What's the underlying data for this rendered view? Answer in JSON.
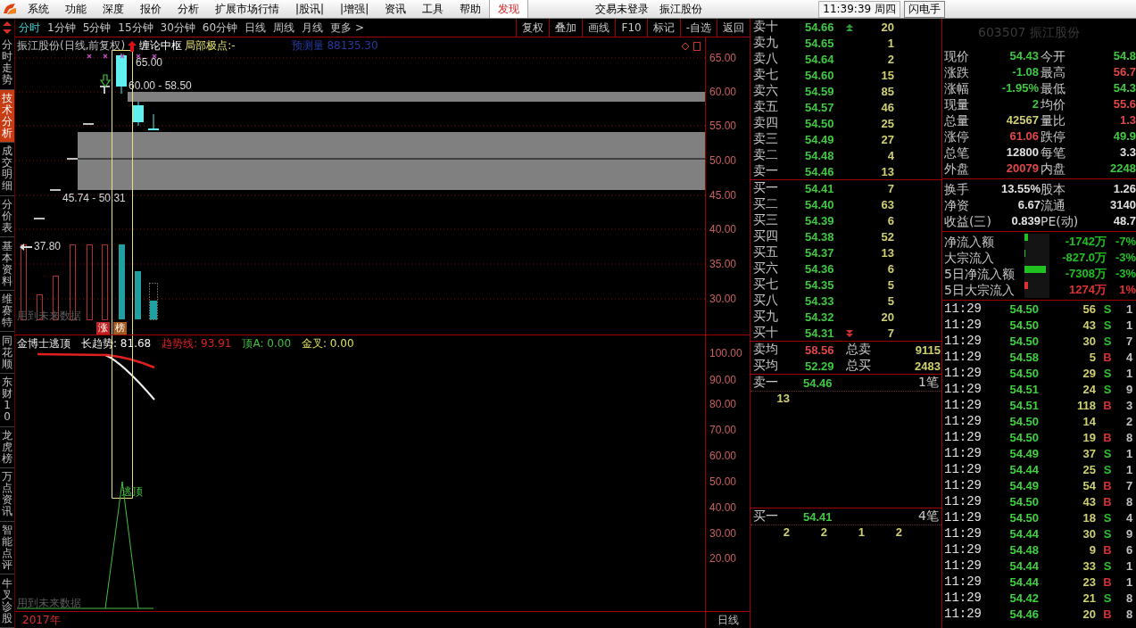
{
  "menu_bar": {
    "items": [
      {
        "label": "系统",
        "highlighted": false
      },
      {
        "label": "功能",
        "highlighted": false
      },
      {
        "label": "深度",
        "highlighted": false
      },
      {
        "label": "报价",
        "highlighted": false
      },
      {
        "label": "分析",
        "highlighted": false
      },
      {
        "label": "扩展市场行情",
        "highlighted": false
      },
      {
        "label": "|股讯|",
        "highlighted": false
      },
      {
        "label": "|增强|",
        "highlighted": false
      },
      {
        "label": "资讯",
        "highlighted": false
      },
      {
        "label": "工具",
        "highlighted": false
      },
      {
        "label": "帮助",
        "highlighted": false
      },
      {
        "label": "发现",
        "highlighted": true
      }
    ],
    "login_status": "交易未登录",
    "stock_name": "振江股份",
    "clock": "11:39:39 周四",
    "button": "闪电手"
  },
  "side_tabs": [
    {
      "label": "分时走势",
      "selected": false
    },
    {
      "label": "技术分析",
      "selected": true
    },
    {
      "label": "成交明细",
      "selected": false
    },
    {
      "label": "分价表",
      "selected": false
    },
    {
      "label": "基本资料",
      "selected": false
    },
    {
      "label": "维赛特",
      "selected": false
    },
    {
      "label": "同花顺",
      "selected": false
    },
    {
      "label": "东财10",
      "selected": false
    },
    {
      "label": "龙虎榜",
      "selected": false
    },
    {
      "label": "万点资讯",
      "selected": false
    },
    {
      "label": "智能点评",
      "selected": false
    },
    {
      "label": "牛叉诊股",
      "selected": false
    }
  ],
  "period_tabs": [
    {
      "label": "分时",
      "selected": true
    },
    {
      "label": "1分钟",
      "selected": false
    },
    {
      "label": "5分钟",
      "selected": false
    },
    {
      "label": "15分钟",
      "selected": false
    },
    {
      "label": "30分钟",
      "selected": false
    },
    {
      "label": "60分钟",
      "selected": false
    },
    {
      "label": "日线",
      "selected": false
    },
    {
      "label": "周线",
      "selected": false
    },
    {
      "label": "月线",
      "selected": false
    },
    {
      "label": "更多 >",
      "selected": false
    }
  ],
  "toolbar_buttons": [
    "复权",
    "叠加",
    "画线",
    "F10",
    "标记",
    "-自选",
    "返回"
  ],
  "main_chart": {
    "title": "振江股份(日线,前复权)",
    "overlay": "缠论中枢",
    "extreme_label": "局部极点:-",
    "forecast": "预测量 88135.30",
    "price_labels": [
      "65.00",
      "60.00 - 58.50",
      "45.74 - 50.31",
      "37.80"
    ],
    "note": "用到未来数据",
    "tags": [
      {
        "label": "涨",
        "color": "#c02020"
      },
      {
        "label": "榜",
        "color": "#a05a20"
      }
    ],
    "y_labels": [
      "65.00",
      "60.00",
      "55.00",
      "50.00",
      "45.00",
      "40.00",
      "35.00",
      "30.00"
    ]
  },
  "indicator_chart": {
    "name": "金博士逃顶",
    "lines": [
      {
        "label": "长趋势: 81.68",
        "color": "#f0f0f0"
      },
      {
        "label": "趋势线: 93.91",
        "color": "#e02020"
      },
      {
        "label": "顶A: 0.00",
        "color": "#40c040"
      },
      {
        "label": "金叉: 0.00",
        "color": "#e0e060"
      }
    ],
    "signal": "逃顶",
    "note": "用到未来数据",
    "y_labels": [
      "100.00",
      "90.00",
      "80.00",
      "70.00",
      "60.00",
      "50.00",
      "40.00",
      "30.00",
      "20.00"
    ]
  },
  "footer": {
    "year": "2017年",
    "period": "日线"
  },
  "order_book": {
    "asks": [
      {
        "label": "卖十",
        "price": "54.66",
        "volume": "20"
      },
      {
        "label": "卖九",
        "price": "54.65",
        "volume": "1"
      },
      {
        "label": "卖八",
        "price": "54.64",
        "volume": "2"
      },
      {
        "label": "卖七",
        "price": "54.60",
        "volume": "15"
      },
      {
        "label": "卖六",
        "price": "54.59",
        "volume": "85"
      },
      {
        "label": "卖五",
        "price": "54.57",
        "volume": "46"
      },
      {
        "label": "卖四",
        "price": "54.50",
        "volume": "25"
      },
      {
        "label": "卖三",
        "price": "54.49",
        "volume": "27"
      },
      {
        "label": "卖二",
        "price": "54.48",
        "volume": "4"
      },
      {
        "label": "卖一",
        "price": "54.46",
        "volume": "13"
      }
    ],
    "bids": [
      {
        "label": "买一",
        "price": "54.41",
        "volume": "7"
      },
      {
        "label": "买二",
        "price": "54.40",
        "volume": "63"
      },
      {
        "label": "买三",
        "price": "54.39",
        "volume": "6"
      },
      {
        "label": "买四",
        "price": "54.38",
        "volume": "52"
      },
      {
        "label": "买五",
        "price": "54.37",
        "volume": "13"
      },
      {
        "label": "买六",
        "price": "54.36",
        "volume": "6"
      },
      {
        "label": "买七",
        "price": "54.35",
        "volume": "5"
      },
      {
        "label": "买八",
        "price": "54.33",
        "volume": "5"
      },
      {
        "label": "买九",
        "price": "54.32",
        "volume": "20"
      },
      {
        "label": "买十",
        "price": "54.31",
        "volume": "7"
      }
    ],
    "averages": [
      {
        "label": "卖均",
        "price": "58.56",
        "color": "#e04848",
        "total_label": "总卖",
        "total": "9115"
      },
      {
        "label": "买均",
        "price": "52.29",
        "color": "#40c840",
        "total_label": "总买",
        "total": "2483"
      }
    ],
    "queues": [
      {
        "label": "卖一",
        "price": "54.46",
        "count": "1笔",
        "orders": [
          "13"
        ]
      },
      {
        "label": "买一",
        "price": "54.41",
        "count": "4笔",
        "orders": [
          "2",
          "2",
          "1",
          "2"
        ]
      }
    ]
  },
  "quote": {
    "title": "603507 振江股份",
    "fields": [
      {
        "label": "现价",
        "value": "54.43",
        "color": "#40c840"
      },
      {
        "label": "今开",
        "value": "54.8",
        "color": "#40c840"
      },
      {
        "label": "涨跌",
        "value": "-1.08",
        "color": "#40c840"
      },
      {
        "label": "最高",
        "value": "56.7",
        "color": "#e04848"
      },
      {
        "label": "涨幅",
        "value": "-1.95%",
        "color": "#40c840"
      },
      {
        "label": "最低",
        "value": "54.3",
        "color": "#40c840"
      },
      {
        "label": "现量",
        "value": "2",
        "color": "#40c840"
      },
      {
        "label": "均价",
        "value": "55.6",
        "color": "#e04848"
      },
      {
        "label": "总量",
        "value": "42567",
        "color": "#d0d070"
      },
      {
        "label": "量比",
        "value": "1.3",
        "color": "#e04848"
      },
      {
        "label": "涨停",
        "value": "61.06",
        "color": "#e04848"
      },
      {
        "label": "跌停",
        "value": "49.9",
        "color": "#40c840"
      },
      {
        "label": "总笔",
        "value": "12800",
        "color": "#e0e0e0"
      },
      {
        "label": "每笔",
        "value": "3.3",
        "color": "#e0e0e0"
      },
      {
        "label": "外盘",
        "value": "20079",
        "color": "#e04848"
      },
      {
        "label": "内盘",
        "value": "2248",
        "color": "#40c840"
      }
    ],
    "fundamentals": [
      {
        "label": "换手",
        "value": "13.55%"
      },
      {
        "label": "股本",
        "value": "1.26"
      },
      {
        "label": "净资",
        "value": "6.67"
      },
      {
        "label": "流通",
        "value": "3140"
      },
      {
        "label": "收益(三)",
        "value": "0.839"
      },
      {
        "label": "PE(动)",
        "value": "48.7"
      }
    ],
    "flows": [
      {
        "label": "净流入额",
        "level": 0.13,
        "color": "#20c020",
        "value": "-1742万",
        "ratio": "-7%"
      },
      {
        "label": "大宗流入",
        "level": 0.05,
        "color": "#20c020",
        "value": "-827.0万",
        "ratio": "-3%"
      },
      {
        "label": "5日净流入额",
        "level": 0.85,
        "color": "#20c020",
        "value": "-7308万",
        "ratio": "-3%"
      },
      {
        "label": "5日大宗流入",
        "level": 0.13,
        "color": "#e03030",
        "value": "1274万",
        "ratio": "1%"
      }
    ]
  },
  "trades": [
    {
      "time": "11:29",
      "price": "54.50",
      "volume": "56",
      "side": "S",
      "color": "#30c030",
      "column_5": "1"
    },
    {
      "time": "11:29",
      "price": "54.50",
      "volume": "43",
      "side": "S",
      "color": "#30c030",
      "column_5": "1"
    },
    {
      "time": "11:29",
      "price": "54.50",
      "volume": "30",
      "side": "S",
      "color": "#30c030",
      "column_5": "7"
    },
    {
      "time": "11:29",
      "price": "54.58",
      "volume": "5",
      "side": "B",
      "color": "#d03030",
      "column_5": "4"
    },
    {
      "time": "11:29",
      "price": "54.50",
      "volume": "29",
      "side": "S",
      "color": "#30c030",
      "column_5": "1"
    },
    {
      "time": "11:29",
      "price": "54.51",
      "volume": "24",
      "side": "S",
      "color": "#30c030",
      "column_5": "9"
    },
    {
      "time": "11:29",
      "price": "54.51",
      "volume": "118",
      "side": "B",
      "color": "#d03030",
      "column_5": "3"
    },
    {
      "time": "11:29",
      "price": "54.50",
      "volume": "14",
      "column_5": "2"
    },
    {
      "time": "11:29",
      "price": "54.50",
      "volume": "19",
      "side": "B",
      "color": "#d03030",
      "column_5": "8"
    },
    {
      "time": "11:29",
      "price": "54.49",
      "volume": "37",
      "side": "S",
      "color": "#30c030",
      "column_5": "1"
    },
    {
      "time": "11:29",
      "price": "54.44",
      "volume": "25",
      "side": "S",
      "color": "#30c030",
      "column_5": "1"
    },
    {
      "time": "11:29",
      "price": "54.49",
      "volume": "54",
      "side": "B",
      "color": "#d03030",
      "column_5": "7"
    },
    {
      "time": "11:29",
      "price": "54.50",
      "volume": "43",
      "side": "B",
      "color": "#d03030",
      "column_5": "8"
    },
    {
      "time": "11:29",
      "price": "54.50",
      "volume": "18",
      "side": "S",
      "color": "#30c030",
      "column_5": "4"
    },
    {
      "time": "11:29",
      "price": "54.44",
      "volume": "30",
      "side": "S",
      "color": "#30c030",
      "column_5": "9"
    },
    {
      "time": "11:29",
      "price": "54.48",
      "volume": "9",
      "side": "B",
      "color": "#d03030",
      "column_5": "6"
    },
    {
      "time": "11:29",
      "price": "54.44",
      "volume": "33",
      "side": "S",
      "color": "#30c030",
      "column_5": "1"
    },
    {
      "time": "11:29",
      "price": "54.44",
      "volume": "23",
      "side": "B",
      "color": "#d03030",
      "column_5": "1"
    },
    {
      "time": "11:29",
      "price": "54.42",
      "volume": "21",
      "side": "S",
      "color": "#30c030",
      "column_5": "8"
    },
    {
      "time": "11:29",
      "price": "54.46",
      "volume": "20",
      "side": "B",
      "color": "#d03030",
      "column_5": "8"
    }
  ]
}
